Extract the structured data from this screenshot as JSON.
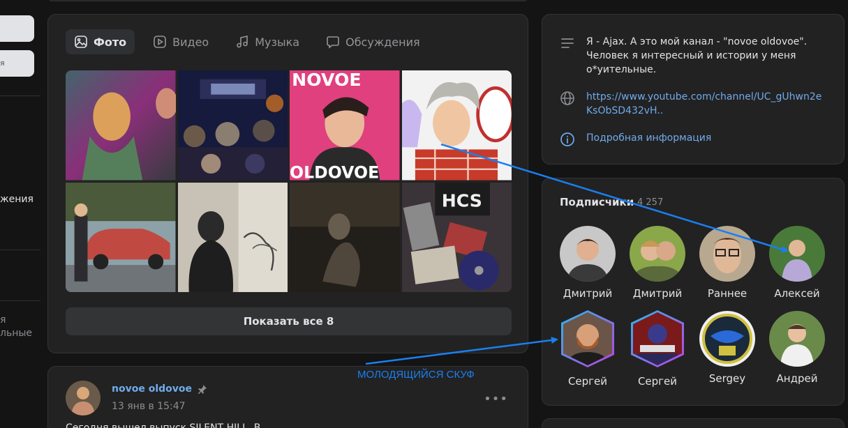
{
  "left_nav": {
    "item_a": "я",
    "item_b": "жения",
    "item_c": "я",
    "item_d": "льные"
  },
  "tabs": [
    {
      "label": "Фото",
      "icon": "photo-icon",
      "active": true
    },
    {
      "label": "Видео",
      "icon": "video-icon",
      "active": false
    },
    {
      "label": "Музыка",
      "icon": "music-icon",
      "active": false
    },
    {
      "label": "Обсуждения",
      "icon": "discussion-icon",
      "active": false
    }
  ],
  "photos": {
    "show_all_label": "Показать все 8",
    "tile3_text_top": "NOVOE",
    "tile3_text_bottom": "OLDOVOE",
    "tile8_text": "HCS"
  },
  "post": {
    "author": "novoe oldovoe",
    "date": "13 янв в 15:47",
    "text": "Сегодня вышел выпуск SILENT HILL. В"
  },
  "info": {
    "description": "Я - Ajax. А это мой канал - \"novoe oldovoe\". Человек я интересный и истории у меня о*уительные.",
    "link": "https://www.youtube.com/channel/UC_gUhwn2eKsObSD432vH..",
    "details_label": "Подробная информация"
  },
  "subscribers": {
    "title": "Подписчики",
    "count": "4 257",
    "people": [
      {
        "name": "Дмитрий"
      },
      {
        "name": "Дмитрий"
      },
      {
        "name": "Раннее"
      },
      {
        "name": "Алексей"
      },
      {
        "name": "Сергей"
      },
      {
        "name": "Сергей"
      },
      {
        "name": "Sergey"
      },
      {
        "name": "Андрей"
      }
    ]
  },
  "annotation": {
    "label": "МОЛОДЯЩИЙСЯ СКУФ"
  },
  "colors": {
    "background": "#141414",
    "card": "#222222",
    "link": "#71aaeb",
    "annotation": "#1a7ff0"
  }
}
